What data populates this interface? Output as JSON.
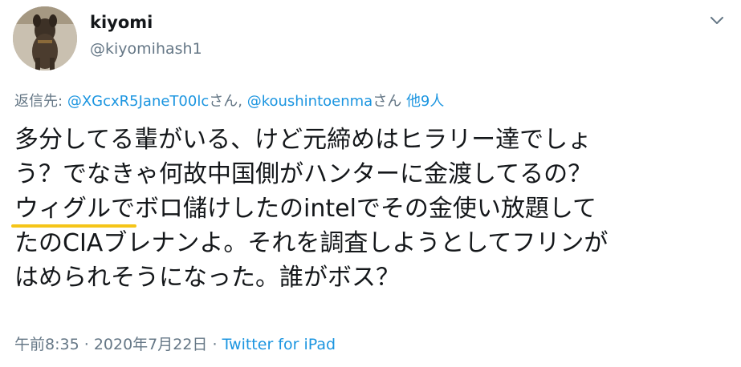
{
  "author": {
    "display_name": "kiyomi",
    "handle": "@kiyomihash1",
    "avatar_icon": "dog-photo-avatar"
  },
  "menu": {
    "icon": "chevron-down-icon"
  },
  "reply_to": {
    "prefix": "返信先:",
    "user1": "@XGcxR5JaneT00lc",
    "user1_suffix": "さん,",
    "user2": "@koushintoenma",
    "user2_suffix": "さん",
    "others": "他9人"
  },
  "tweet": {
    "line1": "多分してる輩がいる、けど元締めはヒラリー達でしょ",
    "line2": "う？でなきゃ何故中国側がハンターに金渡してるの？",
    "line3_highlighted": "ウィグルで",
    "line3_rest": "ボロ儲けしたのintelでその金使い放題して",
    "line4": "たのCIAブレナンよ。それを調査しようとしてフリンが",
    "line5": "はめられそうになった。誰がボス？"
  },
  "meta": {
    "time": "午前8:35",
    "separator1": "·",
    "date": "2020年7月22日",
    "separator2": "·",
    "source": "Twitter for iPad"
  },
  "colors": {
    "link": "#1b95e0",
    "secondary": "#657786",
    "highlight": "#f5c518"
  }
}
